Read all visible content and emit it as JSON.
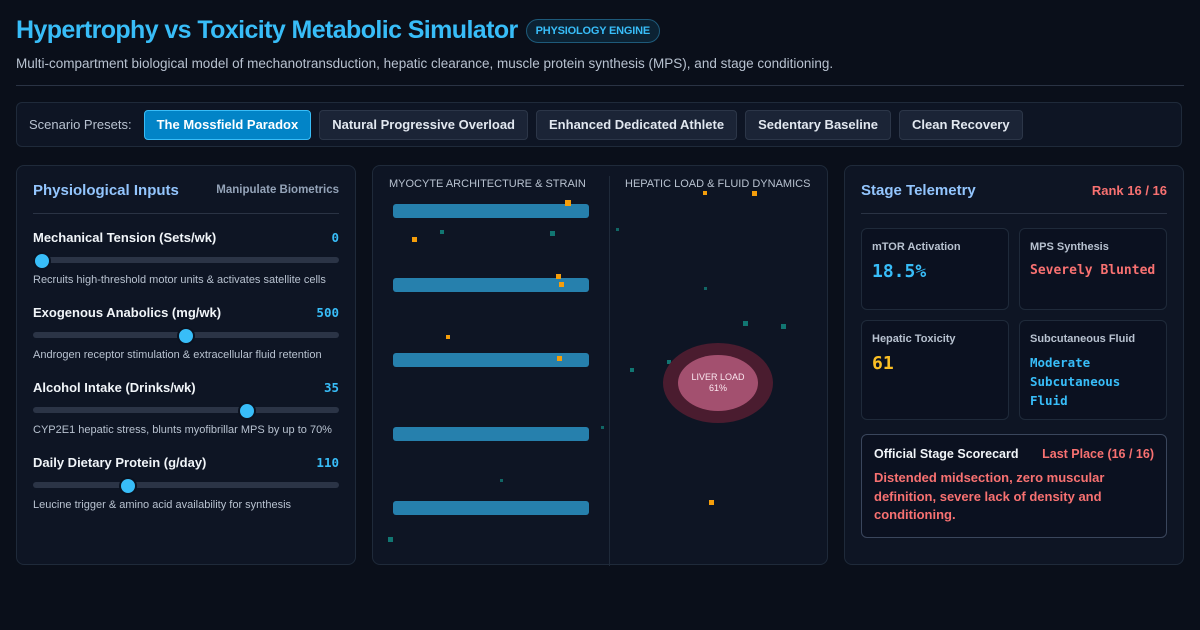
{
  "header": {
    "title": "Hypertrophy vs Toxicity Metabolic Simulator",
    "badge": "PHYSIOLOGY ENGINE",
    "subtitle": "Multi-compartment biological model of mechanotransduction, hepatic clearance, muscle protein synthesis (MPS), and stage conditioning."
  },
  "presets": {
    "label": "Scenario Presets:",
    "items": [
      {
        "label": "The Mossfield Paradox",
        "active": true
      },
      {
        "label": "Natural Progressive Overload",
        "active": false
      },
      {
        "label": "Enhanced Dedicated Athlete",
        "active": false
      },
      {
        "label": "Sedentary Baseline",
        "active": false
      },
      {
        "label": "Clean Recovery",
        "active": false
      }
    ]
  },
  "inputs": {
    "title": "Physiological Inputs",
    "subtitle": "Manipulate Biometrics",
    "controls": [
      {
        "label": "Mechanical Tension (Sets/wk)",
        "value": "0",
        "level": 0.03,
        "desc": "Recruits high-threshold motor units & activates satellite cells"
      },
      {
        "label": "Exogenous Anabolics (mg/wk)",
        "value": "500",
        "level": 0.5,
        "desc": "Androgen receptor stimulation & extracellular fluid retention"
      },
      {
        "label": "Alcohol Intake (Drinks/wk)",
        "value": "35",
        "level": 0.7,
        "desc": "CYP2E1 hepatic stress, blunts myofibrillar MPS by up to 70%"
      },
      {
        "label": "Daily Dietary Protein (g/day)",
        "value": "110",
        "level": 0.31,
        "desc": "Leucine trigger & amino acid availability for synthesis"
      }
    ]
  },
  "viz": {
    "myocyte_label": "MYOCYTE ARCHITECTURE & STRAIN",
    "hepatic_label": "HEPATIC LOAD & FLUID DYNAMICS",
    "liver_label": "LIVER LOAD",
    "liver_value": "61%",
    "colors": {
      "fiber": "#2680ad",
      "speck_orange": "#f59e0b",
      "speck_teal": "#14b8a6",
      "liver": "#a3506f"
    }
  },
  "telemetry": {
    "title": "Stage Telemetry",
    "rank": "Rank 16 / 16",
    "cards": [
      {
        "label": "mTOR Activation",
        "value": "18.5%"
      },
      {
        "label": "MPS Synthesis",
        "value": "Severely Blunted"
      },
      {
        "label": "Hepatic Toxicity",
        "value": "61"
      },
      {
        "label": "Subcutaneous Fluid",
        "value": "Moderate Subcutaneous Fluid"
      }
    ],
    "scorecard": {
      "title": "Official Stage Scorecard",
      "place": "Last Place (16 / 16)",
      "text": "Distended midsection, zero muscular definition, severe lack of density and conditioning."
    }
  }
}
